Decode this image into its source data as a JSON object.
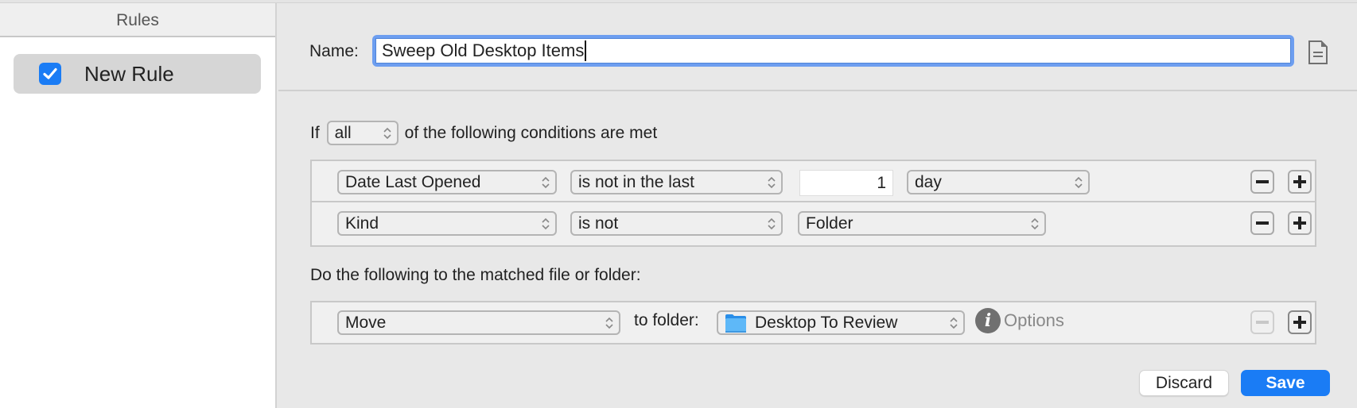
{
  "sidebar": {
    "header": "Rules",
    "rules": [
      {
        "label": "New Rule",
        "enabled": true,
        "selected": true
      }
    ]
  },
  "rule_editor": {
    "name_label": "Name:",
    "name_value": "Sweep Old Desktop Items",
    "doc_icon": "document-icon",
    "conditions_prefix": "If",
    "match_mode": "all",
    "conditions_suffix": "of the following conditions are met",
    "conditions": [
      {
        "attribute": "Date Last Opened",
        "operator": "is not in the last",
        "value": "1",
        "unit": "day"
      },
      {
        "attribute": "Kind",
        "operator": "is not",
        "value": "Folder"
      }
    ],
    "actions_label": "Do the following to the matched file or folder:",
    "actions": [
      {
        "action": "Move",
        "to_label": "to folder:",
        "folder": "Desktop To Review",
        "folder_icon": "folder-icon",
        "options_label": "Options",
        "remove_disabled": true
      }
    ],
    "discard_label": "Discard",
    "save_label": "Save"
  },
  "colors": {
    "accent": "#1a7cf5",
    "focus_ring": "#6d9ef0"
  }
}
